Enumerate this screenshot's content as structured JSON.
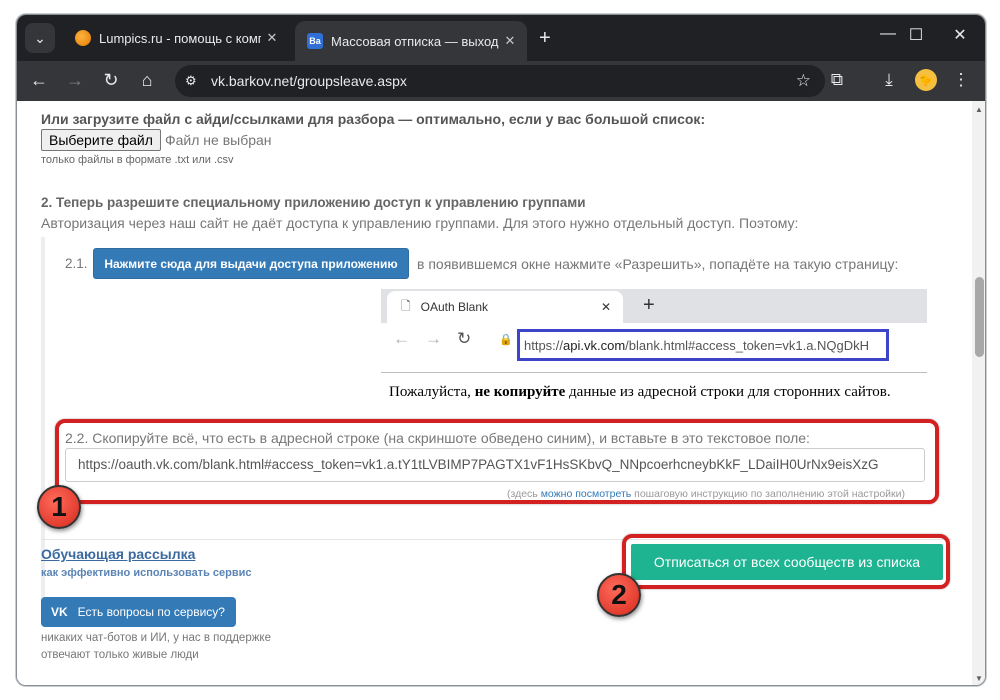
{
  "browser": {
    "tabs": [
      {
        "title": "Lumpics.ru - помощь с компь",
        "active": false
      },
      {
        "title": "Массовая отписка — выход и",
        "active": true
      }
    ],
    "favicon_ba": "Ba",
    "url": "vk.barkov.net/groupsleave.aspx",
    "profile_initial": "🐤"
  },
  "upload": {
    "heading": "Или загрузите файл с айди/ссылками для разбора — оптимально, если у вас большой список:",
    "button": "Выберите файл",
    "no_file": "Файл не выбран",
    "note": "только файлы в формате .txt или .csv"
  },
  "section2": {
    "heading": "2. Теперь разрешите специальному приложению доступ к управлению группами",
    "desc": "Авторизация через наш сайт не даёт доступа к управлению группами. Для этого нужно отдельный доступ. Поэтому:"
  },
  "step21": {
    "number": "2.1.",
    "button": "Нажмите сюда для выдачи доступа приложению",
    "text": "в появившемся окне нажмите «Разрешить», попадёте на такую страницу:"
  },
  "illustration": {
    "tab_title": "OAuth Blank",
    "url_prefix": "https://",
    "url_domain": "api.vk.com",
    "url_rest": "/blank.html#access_token=vk1.a.NQgDkH",
    "warn_before": "Пожалуйста, ",
    "warn_bold": "не копируйте",
    "warn_after": " данные из адресной строки для сторонних сайтов.",
    "frame_color": "#3d44c8"
  },
  "step22": {
    "label": "2.2. Скопируйте всё, что есть в адресной строке (на скриншоте обведено синим), и вставьте в это текстовое поле:",
    "token_value": "https://oauth.vk.com/blank.html#access_token=vk1.a.tY1tLVBIMP7PAGTX1vF1HsSKbvQ_NNpcoerhcneybKkF_LDaiIH0UrNx9eisXzG",
    "hint_before": "(здесь ",
    "hint_link": "можно посмотреть",
    "hint_after": " пошаговую инструкцию по заполнению этой настройки)"
  },
  "footer": {
    "mail_link": "Обучающая рассылка",
    "mail_sub": "как эффективно использовать сервис",
    "vk_logo": "VK",
    "vk_button": "Есть вопросы по сервису?",
    "vk_note1": "никаких чат-ботов и ИИ, у нас в поддержке",
    "vk_note2": "отвечают только живые люди"
  },
  "unsubscribe_button": "Отписаться от всех сообществ из списка",
  "annotations": {
    "badge1": "1",
    "badge2": "2",
    "highlight_color": "#d32020"
  }
}
